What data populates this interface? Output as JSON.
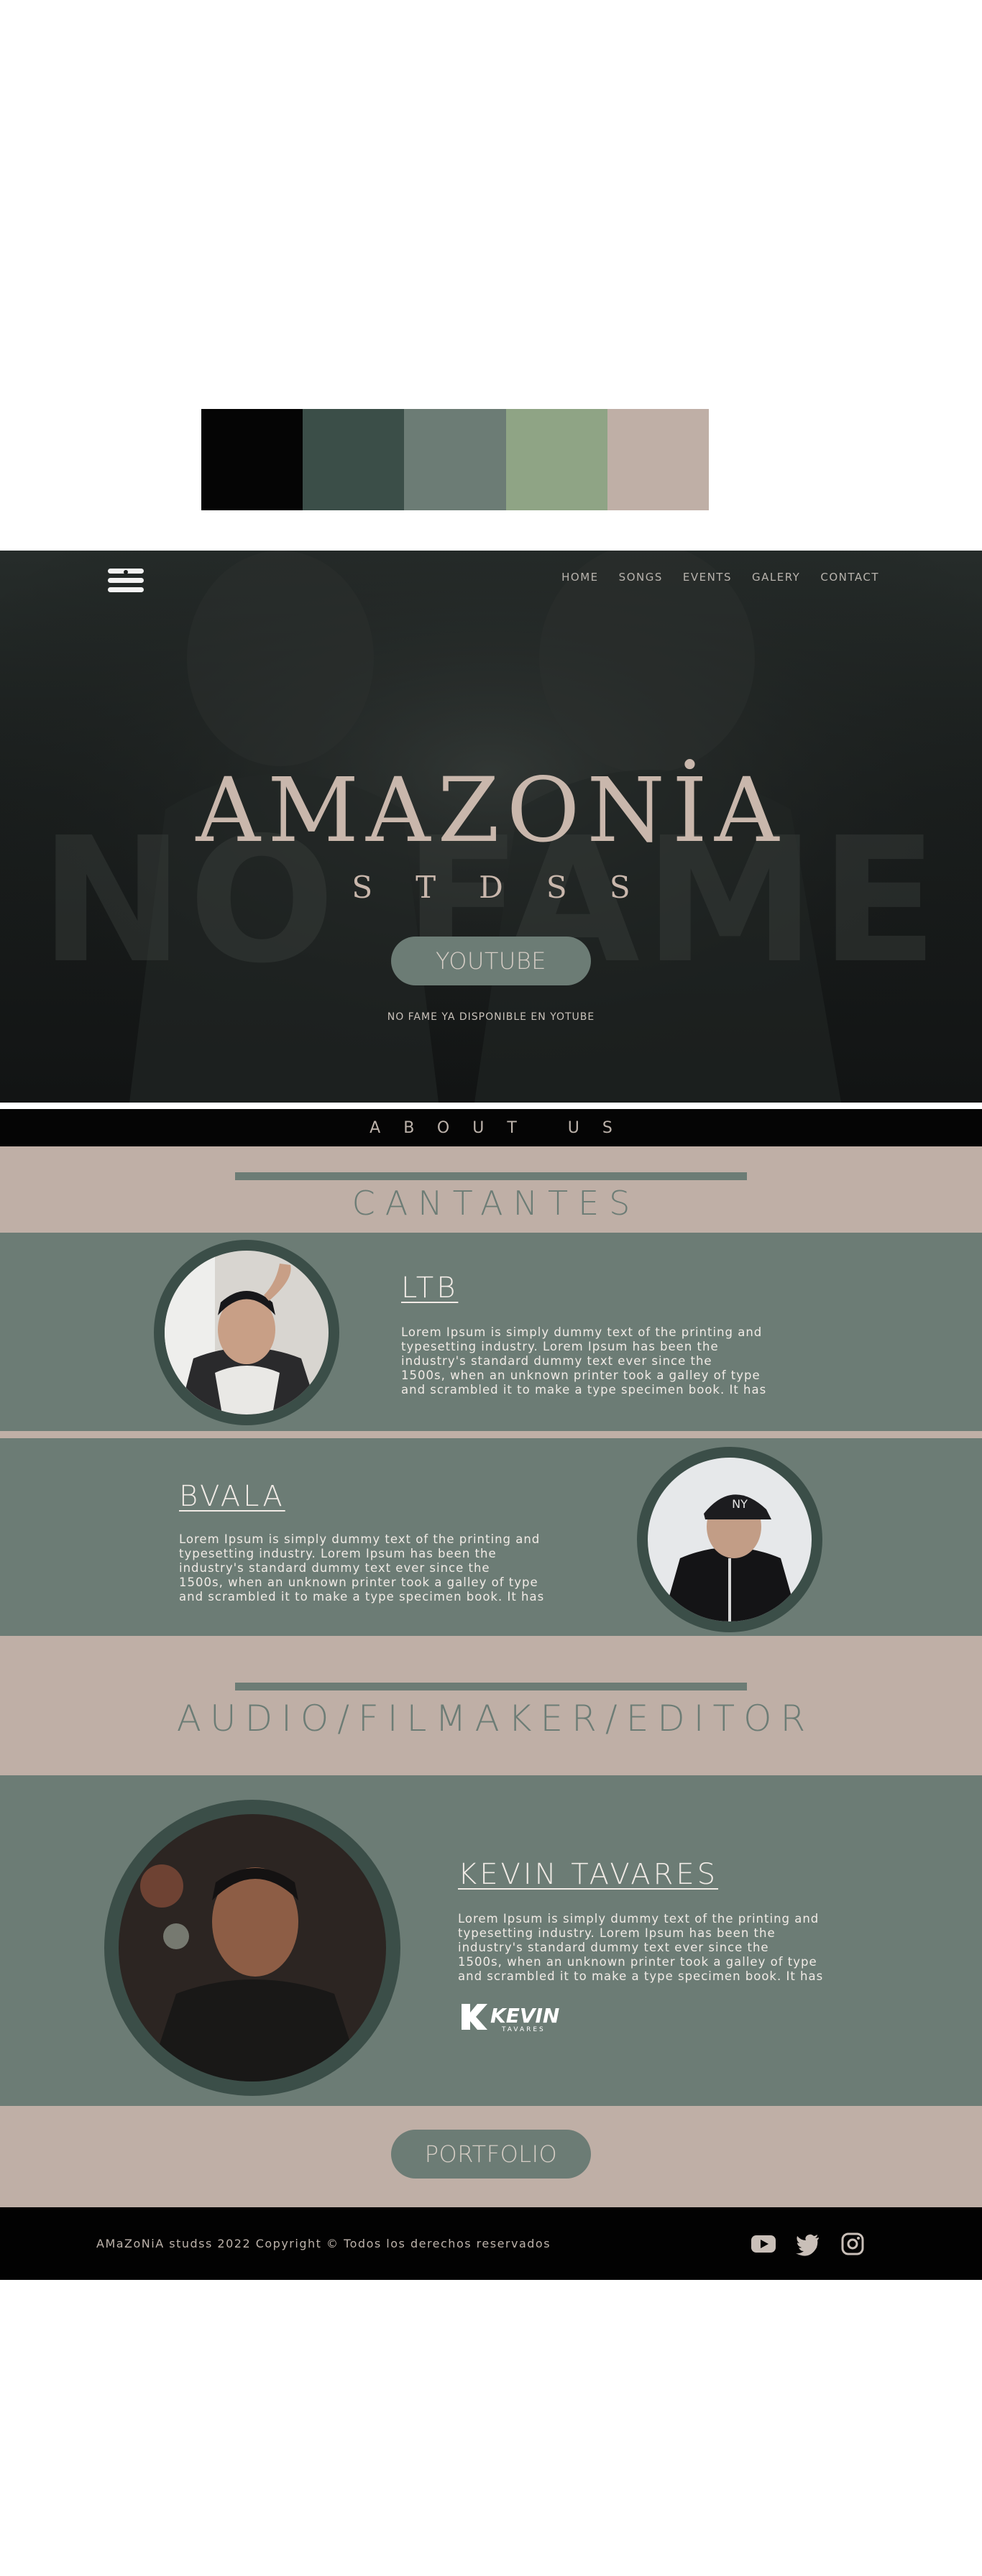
{
  "palette": {
    "colors": [
      "#050505",
      "#3b4e48",
      "#6c7c75",
      "#8fa485",
      "#bfafa6"
    ]
  },
  "hero": {
    "logo_icon": "menu-logo-icon",
    "nav": [
      {
        "label": "HOME"
      },
      {
        "label": "SONGS"
      },
      {
        "label": "EVENTS"
      },
      {
        "label": "GALERY"
      },
      {
        "label": "CONTACT"
      }
    ],
    "title": "AMAZONİA",
    "subtitle": "STDSS",
    "button_label": "YOUTUBE",
    "note": "NO FAME YA DISPONIBLE EN YOTUBE",
    "background_text": "NO FAME"
  },
  "about": {
    "label": "ABOUT US"
  },
  "cantantes": {
    "heading": "CANTANTES",
    "artists": [
      {
        "name": "LTB",
        "bio": [
          "Lorem Ipsum is simply dummy text of the printing and",
          "typesetting industry. Lorem Ipsum has been the",
          "industry's standard dummy text ever since the",
          "1500s, when an unknown printer took a galley of type",
          "and scrambled it to make a type specimen book. It has"
        ]
      },
      {
        "name": "BVALA",
        "bio": [
          "Lorem Ipsum is simply dummy text of the printing and",
          "typesetting industry. Lorem Ipsum has been the",
          "industry's standard dummy text ever since the",
          "1500s, when an unknown printer took a galley of type",
          "and scrambled it to make a type specimen book. It has"
        ]
      }
    ]
  },
  "audio": {
    "heading": "AUDIO/FILMAKER/EDITOR",
    "name": "KEVIN TAVARES",
    "bio": [
      "Lorem Ipsum is simply dummy text of the printing and",
      "typesetting industry. Lorem Ipsum has been the",
      "industry's standard dummy text ever since the",
      "1500s, when an unknown printer took a galley of type",
      "and scrambled it to make a type specimen book. It has"
    ],
    "brand_logo": "Kevin Tavares",
    "button_label": "PORTFOLIO"
  },
  "footer": {
    "copyright": "AMaZoNiA studss 2022 Copyright © Todos los derechos reservados",
    "social_icons": [
      "youtube-icon",
      "twitter-icon",
      "instagram-icon"
    ]
  }
}
